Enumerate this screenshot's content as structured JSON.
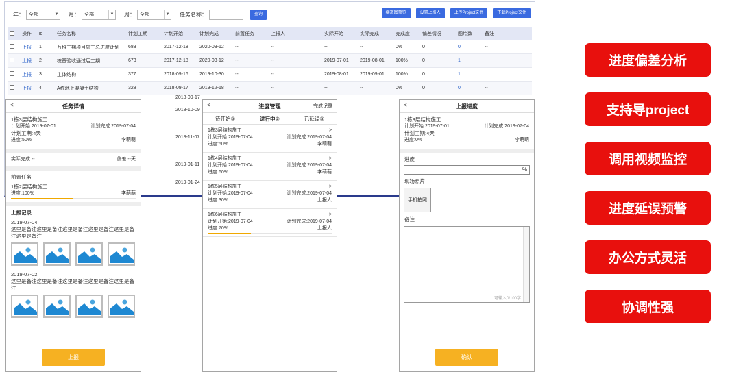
{
  "desk": {
    "filters": {
      "year_label": "年：",
      "year_value": "全部",
      "month_label": "月：",
      "month_value": "全部",
      "week_label": "周：",
      "week_value": "全部",
      "taskname_label": "任务名称：",
      "query_button": "查询"
    },
    "top_buttons": [
      "横道图预览",
      "设置上报人",
      "上传Project文件",
      "下载Project文件"
    ],
    "columns": [
      "操作",
      "id",
      "任务名称",
      "计划工期",
      "计划开始",
      "计划完成",
      "前置任务",
      "上报人",
      "实际开始",
      "实际完成",
      "完成度",
      "偏差情况",
      "图片数",
      "备注"
    ],
    "rows": [
      {
        "op": "上报",
        "id": "1",
        "name": "万科三期项目施工总进度计划",
        "dur": "683",
        "pstart": "2017-12-18",
        "pend": "2020-03-12",
        "pre": "--",
        "reporter": "--",
        "astart": "--",
        "aend": "--",
        "done": "0%",
        "dev": "0",
        "pics": "0",
        "note": "--"
      },
      {
        "op": "上报",
        "id": "2",
        "name": "桩基验收通过后工期",
        "dur": "673",
        "pstart": "2017-12-18",
        "pend": "2020-03-12",
        "pre": "--",
        "reporter": "--",
        "astart": "2019-07-01",
        "aend": "2019-08-01",
        "done": "100%",
        "dev": "0",
        "pics": "1",
        "note": ""
      },
      {
        "op": "上报",
        "id": "3",
        "name": "主体结构",
        "dur": "377",
        "pstart": "2018-09-16",
        "pend": "2019-10-30",
        "pre": "--",
        "reporter": "--",
        "astart": "2019-08-01",
        "aend": "2019-09-01",
        "done": "100%",
        "dev": "0",
        "pics": "1",
        "note": ""
      },
      {
        "op": "上报",
        "id": "4",
        "name": "A栋地上混凝土结构",
        "dur": "328",
        "pstart": "2018-09-17",
        "pend": "2019-12-18",
        "pre": "--",
        "reporter": "--",
        "astart": "--",
        "aend": "--",
        "done": "0%",
        "dev": "0",
        "pics": "0",
        "note": "--"
      }
    ],
    "partial_dates": [
      "2018-09-17",
      "2018-10-09",
      "2018-11-07",
      "2019-01-11",
      "2019-01-24"
    ]
  },
  "detail": {
    "back": "<",
    "title": "任务详情",
    "task": "1栋3层结构施工",
    "plan_start": "计划开始:2019-07-01",
    "plan_end": "计划完成:2019-07-04",
    "duration": "计划工期:4天",
    "progress": "进度:50%",
    "progress_value": 50,
    "person": "李萌萌",
    "actual_done": "实际完成:--",
    "deviation": "偏差:--天",
    "pre_title": "前置任务",
    "pre_task": "1栋2层结构施工",
    "pre_progress": "进度:100%",
    "pre_progress_value": 100,
    "pre_person": "李萌萌",
    "log_title": "上报记录",
    "log1_date": "2019-07-04",
    "log1_text": "这里是备注这里是备注这里是备注这里是备注这里是备注这里是备注",
    "log2_date": "2019-07-02",
    "log2_text": "这里是备注这里是备注这里是备注这里是备注这里是备注",
    "button": "上报"
  },
  "progress_mgmt": {
    "back": "<",
    "title": "进度管理",
    "right": "完成记录",
    "tabs": [
      "待开始③",
      "进行中③",
      "已延误③"
    ],
    "cards": [
      {
        "name": "1栋3层结构施工",
        "start": "计划开始:2019-07-04",
        "end": "计划完成:2019-07-04",
        "progress": "进度:50%",
        "value": 50,
        "person": "李萌萌"
      },
      {
        "name": "1栋4层结构施工",
        "start": "计划开始:2019-07-04",
        "end": "计划完成:2019-07-04",
        "progress": "进度:60%",
        "value": 60,
        "person": "李萌萌"
      },
      {
        "name": "1栋5层结构施工",
        "start": "计划开始:2019-07-04",
        "end": "计划完成:2019-07-04",
        "progress": "进度:30%",
        "value": 30,
        "person": "上报人"
      },
      {
        "name": "1栋6层结构施工",
        "start": "计划开始:2019-07-04",
        "end": "计划完成:2019-07-04",
        "progress": "进度:70%",
        "value": 70,
        "person": "上报人"
      }
    ]
  },
  "report": {
    "back": "<",
    "title": "上报进度",
    "task": "1栋3层结构施工",
    "plan_start": "计划开始:2019-07-01",
    "plan_end": "计划完成:2019-07-04",
    "duration": "计划工期:4天",
    "progress": "进度:0%",
    "progress_value": 0,
    "person": "李萌萌",
    "progress_label": "进度",
    "percent": "%",
    "photo_label": "现场照片",
    "photo_button": "手机拍照",
    "note_label": "备注",
    "counter": "可输入0/100字",
    "button": "确认"
  },
  "features": [
    "进度偏差分析",
    "支持导project",
    "调用视频监控",
    "进度延误预警",
    "办公方式灵活",
    "协调性强"
  ],
  "colors": {
    "feature_red": "#e8100d",
    "accent_blue": "#3a6ae0",
    "button_yellow": "#f6b122",
    "header_bg": "#e3e7f5"
  }
}
